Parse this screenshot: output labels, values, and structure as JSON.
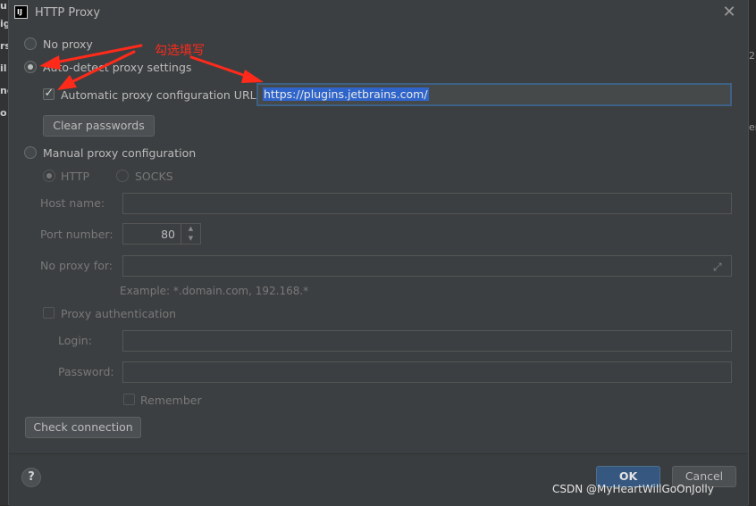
{
  "background": {
    "left_fragments": [
      "u",
      "ig",
      "rs",
      "il",
      "nc",
      "o"
    ],
    "right_fragments": [
      "2",
      "er"
    ]
  },
  "dialog": {
    "title": "HTTP Proxy",
    "app_icon_text": "IJ",
    "close_glyph": "✕"
  },
  "proxy_options": {
    "no_proxy": "No proxy",
    "auto_detect": "Auto-detect proxy settings",
    "auto_config_label": "Automatic proxy configuration URL:",
    "auto_config_checked": true,
    "auto_config_url": "https://plugins.jetbrains.com/",
    "clear_passwords": "Clear passwords",
    "manual": "Manual proxy configuration",
    "selected": "auto_detect"
  },
  "manual": {
    "http": "HTTP",
    "socks": "SOCKS",
    "host_name_label": "Host name:",
    "host_name_value": "",
    "port_number_label": "Port number:",
    "port_number_value": "80",
    "no_proxy_for_label": "No proxy for:",
    "no_proxy_for_value": "",
    "example": "Example: *.domain.com, 192.168.*",
    "proxy_auth": "Proxy authentication",
    "login_label": "Login:",
    "password_label": "Password:",
    "remember": "Remember"
  },
  "buttons": {
    "check_connection": "Check connection",
    "ok": "OK",
    "cancel": "Cancel",
    "help": "?"
  },
  "annotation": {
    "text": "勾选填写",
    "color": "#ff2a1a"
  },
  "watermark": "CSDN @MyHeartWillGoOnJolly",
  "colors": {
    "dialog_bg": "#3c3f41",
    "primary_button": "#365880",
    "selection": "#2f65ca",
    "focus_border": "#3d6185"
  }
}
